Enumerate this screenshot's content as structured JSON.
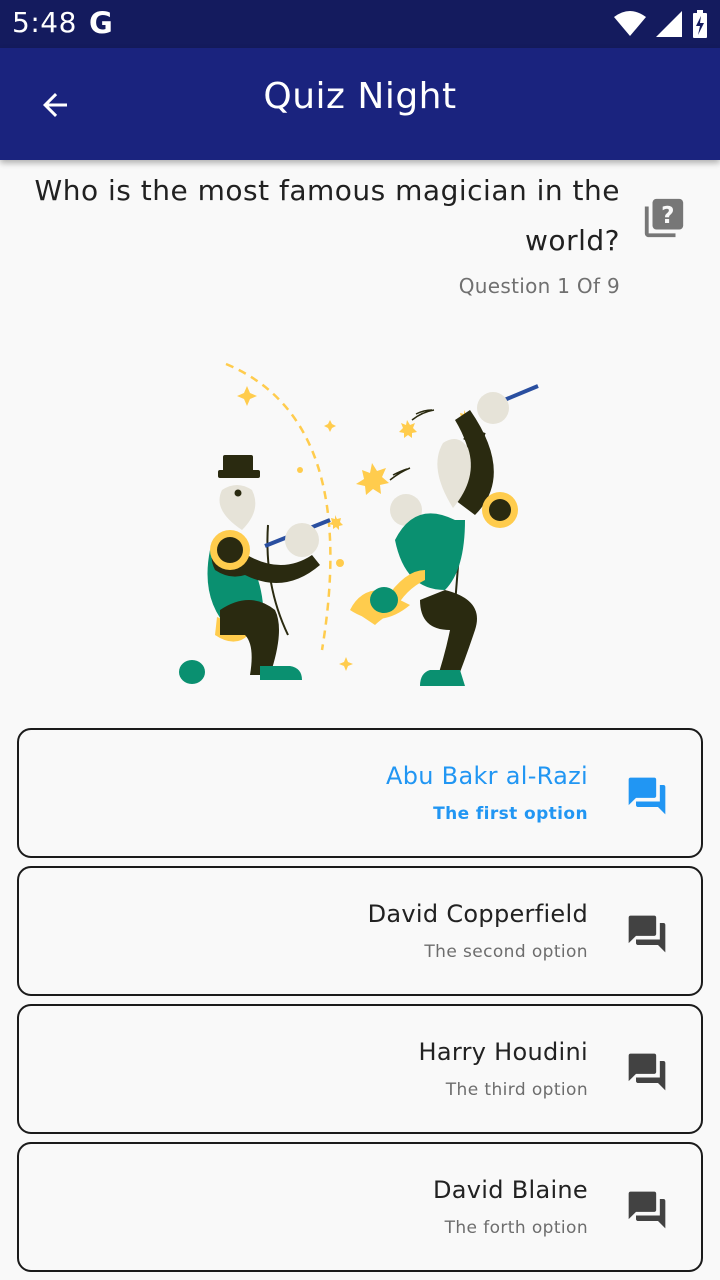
{
  "status_bar": {
    "time": "5:48",
    "g_label": "G"
  },
  "app_bar": {
    "title": "Quiz Night",
    "back_icon": "arrow-back-icon"
  },
  "question": {
    "text": "Who is the most famous magician in the world?",
    "counter": "Question 1 Of 9",
    "hint_icon": "quiz-help-icon"
  },
  "options": [
    {
      "title": "Abu Bakr al-Razi",
      "subtitle": "The first option",
      "selected": true,
      "accent": "#2196f3"
    },
    {
      "title": "David Copperfield",
      "subtitle": "The second option",
      "selected": false
    },
    {
      "title": "Harry Houdini",
      "subtitle": "The third option",
      "selected": false
    },
    {
      "title": "David Blaine",
      "subtitle": "The forth option",
      "selected": false
    }
  ],
  "colors": {
    "app_bar": "#1a237e",
    "status_bar": "#141b5e",
    "selected": "#2196f3",
    "icon_default": "#424242"
  }
}
